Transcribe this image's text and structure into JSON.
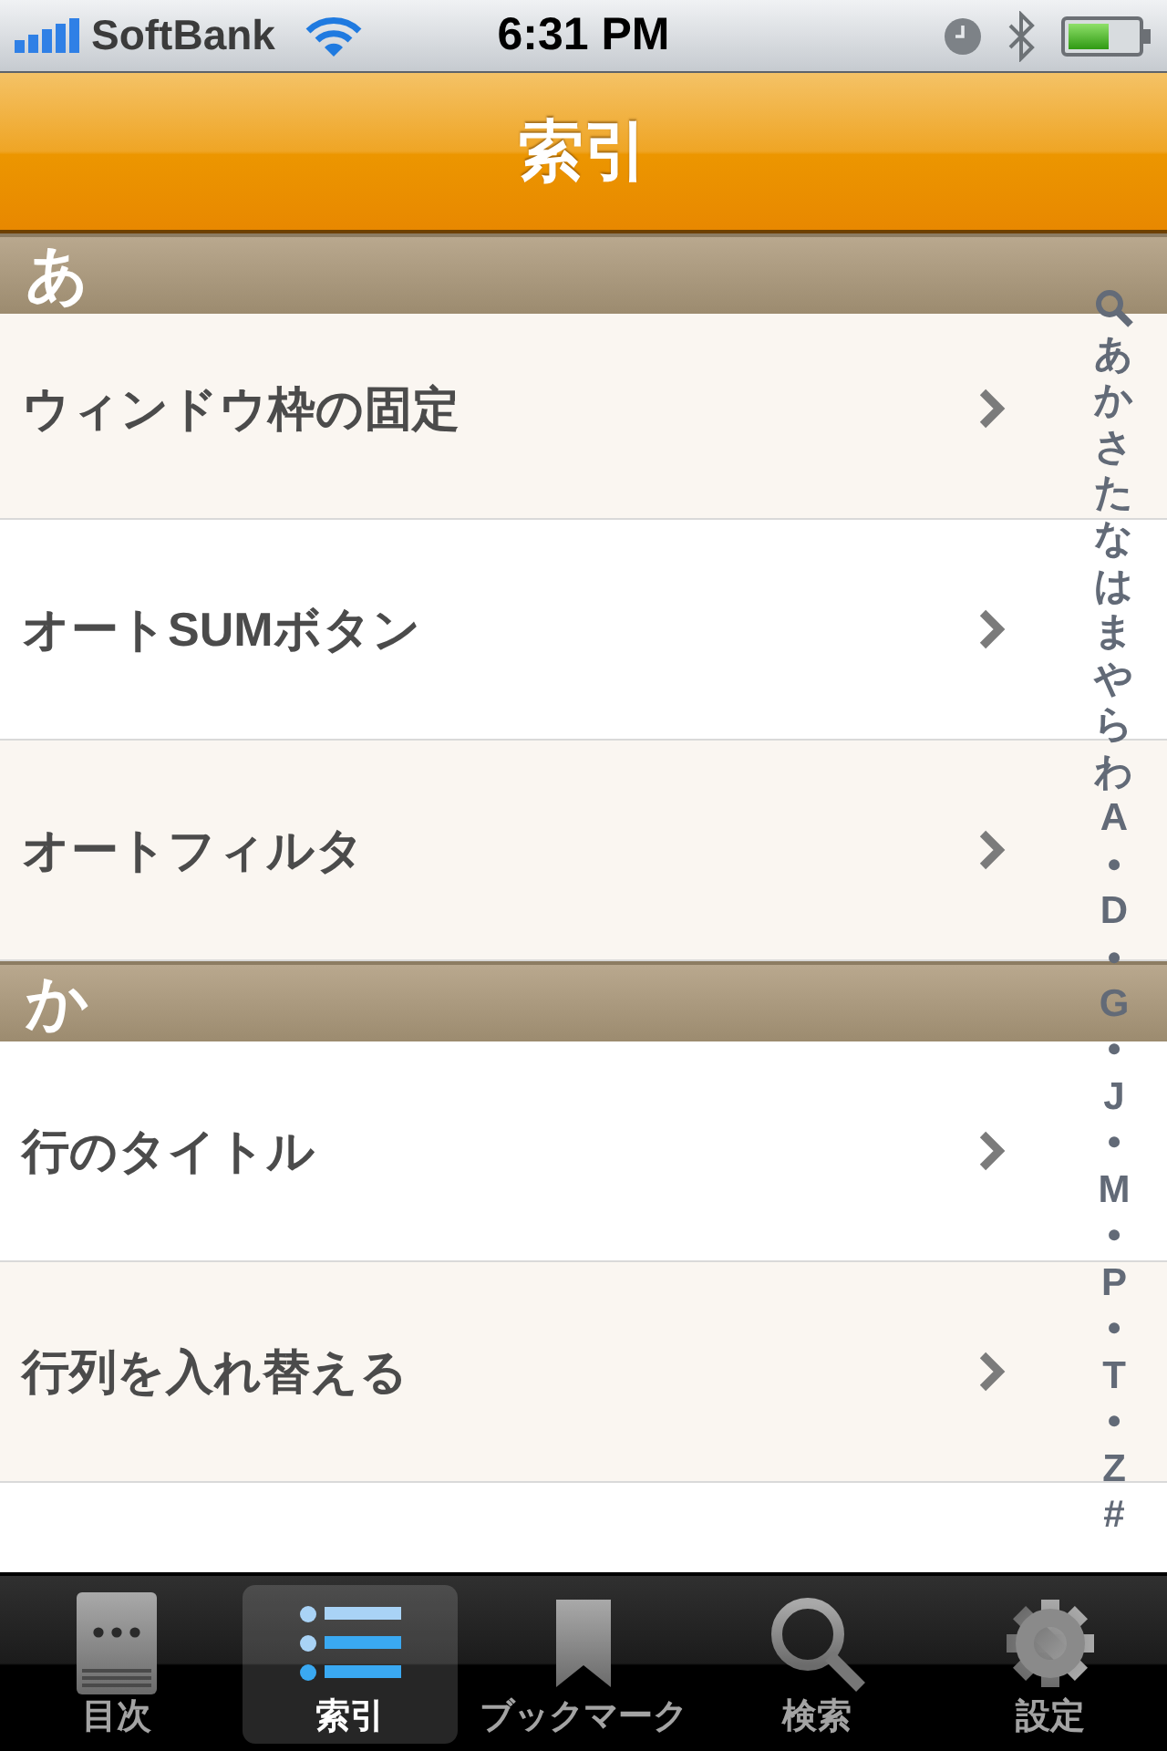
{
  "status_bar": {
    "carrier": "SoftBank",
    "time": "6:31 PM"
  },
  "nav_bar": {
    "title": "索引"
  },
  "sections": [
    {
      "header": "あ",
      "rows": [
        {
          "label": "ウィンドウ枠の固定"
        },
        {
          "label": "オートSUMボタン"
        },
        {
          "label": "オートフィルタ"
        }
      ]
    },
    {
      "header": "か",
      "rows": [
        {
          "label": "行のタイトル"
        },
        {
          "label": "行列を入れ替える"
        }
      ]
    }
  ],
  "index_bar": {
    "items": [
      "あ",
      "か",
      "さ",
      "た",
      "な",
      "は",
      "ま",
      "や",
      "ら",
      "わ",
      "A",
      "•",
      "D",
      "•",
      "G",
      "•",
      "J",
      "•",
      "M",
      "•",
      "P",
      "•",
      "T",
      "•",
      "Z",
      "#"
    ]
  },
  "tab_bar": [
    {
      "label": "目次",
      "selected": false
    },
    {
      "label": "索引",
      "selected": true
    },
    {
      "label": "ブックマーク",
      "selected": false
    },
    {
      "label": "検索",
      "selected": false
    },
    {
      "label": "設定",
      "selected": false
    }
  ]
}
